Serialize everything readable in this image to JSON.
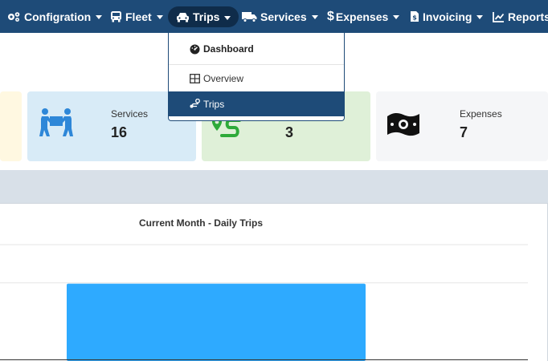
{
  "navbar": {
    "items": [
      {
        "label": "Configration",
        "icon": "gears-icon",
        "has_caret": true
      },
      {
        "label": "Fleet",
        "icon": "bus-icon",
        "has_caret": true
      },
      {
        "label": "Trips",
        "icon": "car-icon",
        "has_caret": true,
        "active": true
      },
      {
        "label": "Services",
        "icon": "truck-icon",
        "has_caret": true
      },
      {
        "label": "Expenses",
        "icon": "dollar-icon",
        "has_caret": true
      },
      {
        "label": "Invoicing",
        "icon": "invoice-icon",
        "has_caret": true
      },
      {
        "label": "Reports",
        "icon": "chart-line-icon",
        "has_caret": false
      }
    ],
    "bg_color": "#1e4b78"
  },
  "trips_dropdown": {
    "header": "Dashboard",
    "items": [
      {
        "label": "Overview",
        "icon": "table-icon"
      },
      {
        "label": "Trips",
        "icon": "route-icon",
        "selected": true
      }
    ]
  },
  "cards": [
    {
      "label": "",
      "value": "",
      "bg": "#fff8e1"
    },
    {
      "label": "Services",
      "value": "16",
      "icon": "people-carry-icon",
      "bg": "#d8ebf7",
      "icon_color": "#2e87d8"
    },
    {
      "label": "",
      "value": "3",
      "icon": "route-icon",
      "bg": "#dff0d8",
      "icon_color": "#2eaa3a"
    },
    {
      "label": "Expenses",
      "value": "7",
      "icon": "money-bill-icon",
      "bg": "#f5f6f8",
      "icon_color": "#111111"
    }
  ],
  "chart": {
    "title": "Current Month - Daily Trips",
    "bar_color": "#2eaaff"
  },
  "chart_data": {
    "type": "bar",
    "title": "Current Month - Daily Trips",
    "categories": [
      ""
    ],
    "values": [
      1
    ],
    "ylim": [
      0,
      1.5
    ],
    "grid": true
  }
}
